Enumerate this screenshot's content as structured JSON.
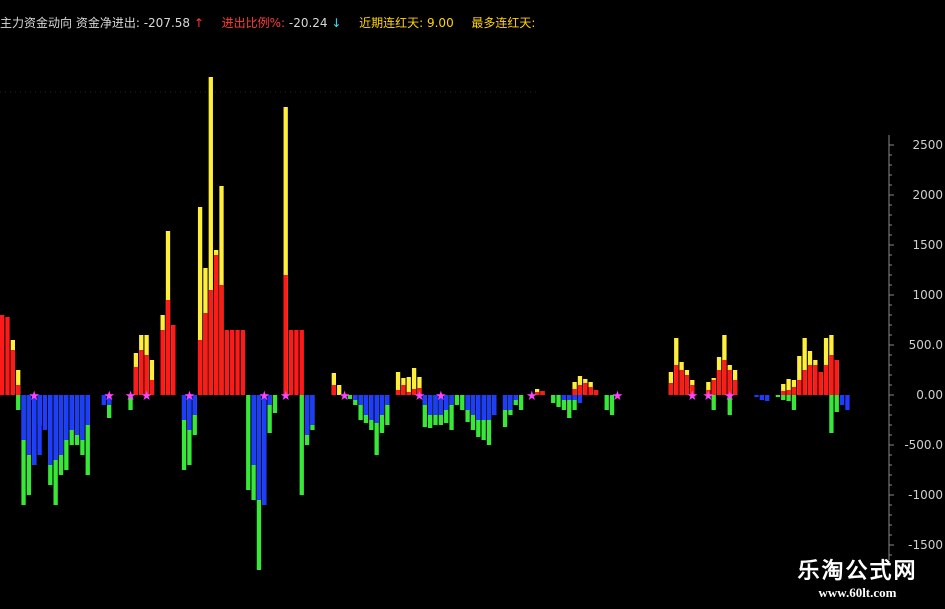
{
  "header": {
    "title": "主力资金动向",
    "net_flow_label": "资金净进出:",
    "net_flow_value": "-207.58",
    "net_flow_arrow": "↑",
    "ratio_label": "进出比例%:",
    "ratio_value": "-20.24",
    "ratio_arrow": "↓",
    "recent_label": "近期连红天:",
    "recent_value": "9.00",
    "max_label": "最多连红天:",
    "max_value": ""
  },
  "watermark": {
    "brand": "乐淘公式网",
    "url": "www.60lt.com"
  },
  "colors": {
    "background": "#000000",
    "red": "#ff1a1a",
    "yellow": "#ffee3a",
    "blue": "#1f3bff",
    "green": "#38e838",
    "star": "#ff44ff",
    "axis": "#888888",
    "tick_text": "#cfcfcf"
  },
  "chart_data": {
    "type": "bar",
    "ylim": [
      -1500,
      2500
    ],
    "yticks": [
      "2500",
      "2000",
      "1500",
      "1000",
      "500.0",
      "0.00",
      "-500.0",
      "-1000",
      "-1500"
    ],
    "ytick_values": [
      2500,
      2000,
      1500,
      1000,
      500,
      0,
      -500,
      -1000,
      -1500
    ],
    "grid": false,
    "series": [
      {
        "values": [
          800,
          780,
          450,
          100,
          0,
          0,
          0,
          0,
          0,
          0,
          0,
          0,
          0,
          0,
          0,
          0,
          0,
          0,
          0,
          0,
          0,
          0,
          0,
          0,
          0,
          280,
          450,
          400,
          150,
          0,
          650,
          950,
          700,
          0,
          0,
          0,
          0,
          550,
          820,
          1050,
          1400,
          1100,
          650,
          650,
          650,
          650,
          0,
          0,
          0,
          0,
          0,
          0,
          0,
          1200,
          650,
          650,
          650,
          0,
          0,
          0,
          0,
          0,
          100,
          0,
          0,
          0,
          0,
          0,
          0,
          0,
          0,
          0,
          0,
          0,
          50,
          100,
          30,
          60,
          70,
          0,
          0,
          0,
          0,
          0,
          0,
          0,
          0,
          0,
          0,
          0,
          0,
          0,
          0,
          0,
          0,
          0,
          0,
          0,
          0,
          0,
          30,
          40,
          0,
          0,
          0,
          0,
          0,
          60,
          100,
          120,
          80,
          50,
          0,
          0,
          0,
          0,
          0,
          0,
          0,
          0,
          0,
          0,
          0,
          0,
          0,
          120,
          300,
          250,
          200,
          100,
          0,
          0,
          50,
          150,
          250,
          350,
          250,
          150,
          0,
          0,
          0,
          0,
          0,
          0,
          0,
          0,
          40,
          50,
          80,
          150,
          250,
          300,
          300,
          230,
          300,
          400,
          350,
          0,
          0
        ]
      },
      {
        "values": [
          0,
          0,
          0,
          0,
          0,
          0,
          0,
          0,
          0,
          0,
          0,
          0,
          0,
          0,
          0,
          0,
          0,
          0,
          0,
          0,
          0,
          0,
          0,
          0,
          0,
          0,
          0,
          0,
          0,
          0,
          0,
          0,
          0,
          0,
          0,
          0,
          0,
          0,
          0,
          0,
          0,
          0,
          0,
          0,
          0,
          0,
          0,
          0,
          0,
          0,
          0,
          0,
          0,
          0,
          0,
          0,
          0,
          0,
          0,
          0,
          0,
          0,
          0,
          0,
          0,
          0,
          0,
          0,
          0,
          0,
          0,
          0,
          0,
          0,
          0,
          0,
          0,
          0,
          0,
          0,
          0,
          0,
          0,
          0,
          0,
          0,
          0,
          0,
          0,
          0,
          0,
          0,
          0,
          0,
          0,
          0,
          0,
          0,
          0,
          0,
          0,
          0,
          0,
          0,
          0,
          0,
          0,
          0,
          0,
          0,
          0,
          0,
          0,
          0,
          0,
          0,
          0,
          0,
          0,
          0,
          0,
          0,
          0,
          0,
          0,
          0,
          0,
          0,
          0,
          0,
          0,
          0,
          0,
          0,
          0,
          0,
          0,
          0,
          0,
          0,
          0,
          0,
          0,
          0,
          0,
          0,
          0,
          0,
          0,
          0,
          0,
          0,
          0,
          0,
          0,
          0,
          0,
          0,
          0,
          0,
          0,
          0,
          0
        ]
      },
      {
        "values": [
          0,
          0,
          0,
          0,
          -450,
          -600,
          -700,
          -600,
          -350,
          -700,
          -650,
          -600,
          -450,
          -350,
          -400,
          -450,
          -300,
          0,
          0,
          -100,
          -100,
          0,
          0,
          0,
          0,
          0,
          0,
          0,
          0,
          0,
          0,
          0,
          0,
          0,
          -250,
          -350,
          -200,
          0,
          0,
          0,
          0,
          0,
          0,
          0,
          0,
          0,
          0,
          -700,
          -1050,
          -1100,
          -100,
          0,
          0,
          0,
          0,
          0,
          0,
          -400,
          -300,
          0,
          0,
          0,
          0,
          0,
          0,
          0,
          -50,
          -100,
          -200,
          -250,
          -280,
          -200,
          -100,
          0,
          0,
          0,
          0,
          0,
          0,
          -100,
          -200,
          -200,
          -200,
          -150,
          -100,
          0,
          0,
          -150,
          -200,
          -250,
          -250,
          -250,
          -200,
          0,
          -150,
          -150,
          -50,
          0,
          0,
          0,
          0,
          0,
          0,
          0,
          0,
          -50,
          -50,
          -50,
          -80,
          0,
          0,
          0,
          0,
          0,
          0,
          0,
          0,
          0,
          0,
          0,
          0,
          0,
          0,
          0,
          0,
          0,
          0,
          0,
          0,
          0,
          0,
          0,
          0,
          0,
          0,
          0,
          0,
          0,
          0,
          0,
          0,
          -20,
          -50,
          -60,
          0,
          0,
          0,
          0,
          0,
          0,
          0,
          0,
          0,
          0,
          0,
          0,
          0,
          -100,
          -150
        ]
      },
      {
        "values": [
          0,
          0,
          0,
          -150,
          -1100,
          -1000,
          -700,
          -300,
          0,
          -900,
          -1100,
          -800,
          -750,
          -500,
          -500,
          -600,
          -800,
          0,
          0,
          0,
          -230,
          0,
          0,
          0,
          -150,
          0,
          0,
          0,
          0,
          0,
          0,
          0,
          0,
          0,
          -750,
          -700,
          -400,
          0,
          0,
          0,
          0,
          0,
          0,
          0,
          0,
          0,
          -950,
          -1050,
          -1750,
          -1100,
          -380,
          -180,
          0,
          0,
          0,
          0,
          -1000,
          -500,
          -350,
          0,
          0,
          0,
          0,
          0,
          0,
          -40,
          -100,
          -250,
          -280,
          -350,
          -600,
          -380,
          -300,
          0,
          0,
          0,
          0,
          0,
          0,
          -320,
          -330,
          -300,
          -300,
          -280,
          -350,
          -100,
          -150,
          -270,
          -350,
          -420,
          -450,
          -500,
          -200,
          0,
          -320,
          -200,
          -100,
          -150,
          0,
          0,
          0,
          0,
          0,
          -80,
          -120,
          -150,
          -230,
          -150,
          0,
          0,
          0,
          0,
          0,
          -150,
          -200,
          0,
          0,
          0,
          0,
          0,
          0,
          0,
          0,
          0,
          0,
          0,
          0,
          0,
          0,
          0,
          0,
          0,
          0,
          -150,
          0,
          0,
          -200,
          0,
          0,
          0,
          0,
          0,
          0,
          0,
          0,
          -20,
          -50,
          -60,
          -150,
          0,
          0,
          0,
          0,
          0,
          0,
          -380,
          -170
        ]
      },
      {
        "values": [
          0,
          0,
          550,
          250,
          0,
          0,
          0,
          0,
          0,
          0,
          0,
          0,
          0,
          0,
          0,
          0,
          0,
          0,
          0,
          0,
          0,
          0,
          0,
          0,
          0,
          420,
          600,
          600,
          350,
          0,
          800,
          1640,
          700,
          0,
          0,
          0,
          0,
          1880,
          1270,
          3180,
          1450,
          2090,
          0,
          0,
          0,
          0,
          0,
          0,
          0,
          0,
          0,
          0,
          0,
          2880,
          0,
          0,
          0,
          0,
          0,
          0,
          0,
          0,
          220,
          100,
          0,
          0,
          0,
          0,
          0,
          0,
          0,
          0,
          0,
          0,
          230,
          170,
          180,
          270,
          180,
          0,
          0,
          0,
          0,
          0,
          0,
          0,
          0,
          0,
          0,
          0,
          0,
          0,
          0,
          0,
          0,
          0,
          0,
          0,
          0,
          0,
          60,
          40,
          0,
          0,
          0,
          0,
          0,
          130,
          190,
          160,
          130,
          50,
          0,
          0,
          0,
          0,
          0,
          0,
          0,
          0,
          0,
          0,
          0,
          0,
          0,
          230,
          570,
          330,
          250,
          150,
          0,
          0,
          130,
          170,
          380,
          600,
          300,
          250,
          0,
          0,
          0,
          0,
          0,
          0,
          0,
          0,
          110,
          160,
          150,
          390,
          570,
          440,
          350,
          230,
          570,
          600,
          350,
          0,
          0
        ]
      }
    ],
    "stars_at": [
      6,
      20,
      24,
      27,
      35,
      49,
      53,
      64,
      78,
      82,
      99,
      115,
      129,
      132,
      136
    ]
  }
}
